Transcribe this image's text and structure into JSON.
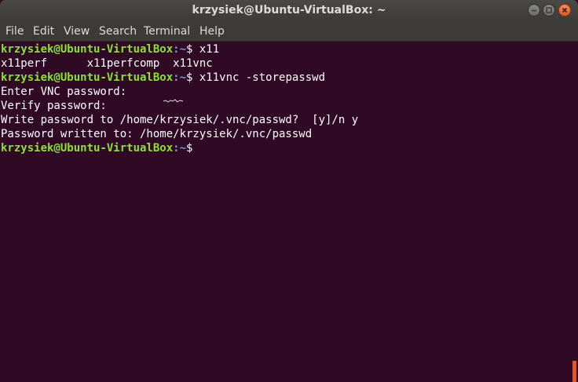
{
  "window": {
    "title": "krzysiek@Ubuntu-VirtualBox: ~"
  },
  "menu": {
    "items": [
      "File",
      "Edit",
      "View",
      "Search",
      "Terminal",
      "Help"
    ]
  },
  "terminal": {
    "prompt_user_host": "krzysiek@Ubuntu-VirtualBox",
    "prompt_path": ":~",
    "prompt_sign": "$",
    "lines": [
      {
        "type": "prompt",
        "command": " x11"
      },
      {
        "type": "output",
        "text": "x11perf      x11perfcomp  x11vnc"
      },
      {
        "type": "prompt",
        "command": " x11vnc -storepasswd"
      },
      {
        "type": "output",
        "text": "Enter VNC password:"
      },
      {
        "type": "output",
        "text": "Verify password:"
      },
      {
        "type": "output",
        "text": "Write password to /home/krzysiek/.vnc/passwd?  [y]/n y"
      },
      {
        "type": "output",
        "text": "Password written to: /home/krzysiek/.vnc/passwd"
      },
      {
        "type": "prompt",
        "command": ""
      }
    ]
  },
  "colors": {
    "background": "#300a24",
    "prompt_user": "#8ae234",
    "prompt_path": "#729fcf",
    "text": "#ffffff",
    "titlebar": "#3c3b37",
    "accent": "#e95420"
  },
  "icons": {
    "minimize": "minimize-icon",
    "maximize": "maximize-icon",
    "close": "close-icon"
  }
}
